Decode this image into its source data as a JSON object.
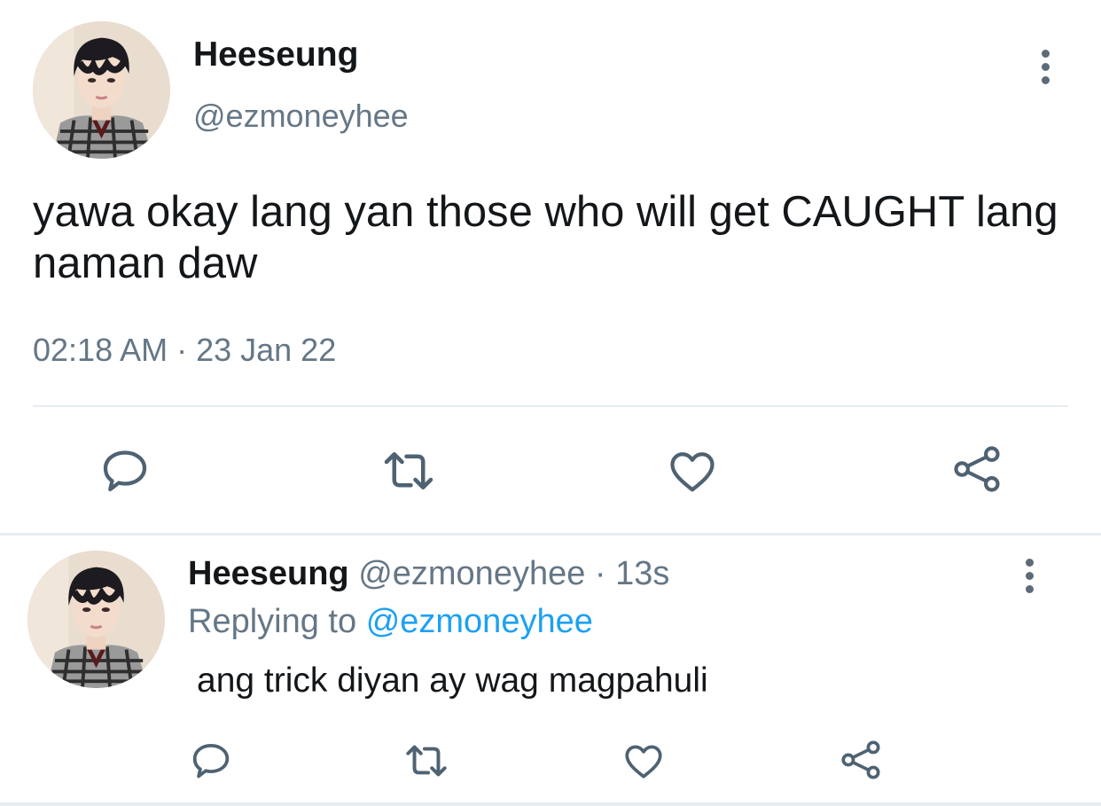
{
  "main_tweet": {
    "display_name": "Heeseung",
    "handle": "@ezmoneyhee",
    "text": "yawa okay lang yan those who will get CAUGHT lang naman daw",
    "timestamp": "02:18 AM · 23 Jan 22",
    "actions": [
      "reply-icon",
      "retweet-icon",
      "like-icon",
      "share-icon"
    ]
  },
  "reply_tweet": {
    "display_name": "Heeseung",
    "handle_meta": "@ezmoneyhee · 13s",
    "replying_prefix": "Replying to",
    "replying_handle": "@ezmoneyhee",
    "text": "ang trick diyan ay wag magpahuli",
    "actions": [
      "reply-icon",
      "retweet-icon",
      "like-icon",
      "share-icon"
    ]
  },
  "colors": {
    "text_primary": "#14171a",
    "text_secondary": "#657786",
    "link": "#1da1f2",
    "icon": "#4e6272",
    "divider": "#e6ecf0"
  }
}
